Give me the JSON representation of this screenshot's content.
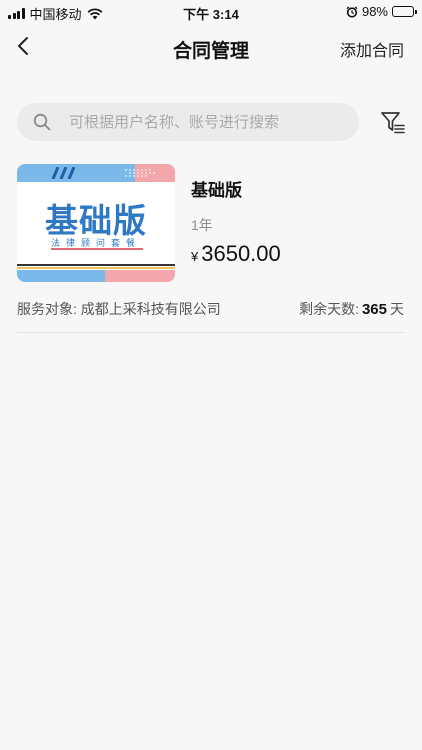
{
  "status_bar": {
    "carrier": "中国移动",
    "time": "下午 3:14",
    "battery": "98%"
  },
  "nav": {
    "title": "合同管理",
    "action": "添加合同"
  },
  "search": {
    "placeholder": "可根据用户名称、账号进行搜索",
    "value": ""
  },
  "contracts": [
    {
      "thumbnail": {
        "title": "基础版",
        "subtitle": "法律顾问套餐"
      },
      "name": "基础版",
      "period": "1年",
      "currency": "¥",
      "price": "3650.00",
      "service_label": "服务对象:",
      "service_target": "成都上采科技有限公司",
      "remaining_label": "剩余天数:",
      "remaining_days": "365",
      "remaining_unit": "天"
    }
  ],
  "colors": {
    "accent_blue": "#2f79c4",
    "band_blue": "#7ab9ea",
    "band_pink": "#f4a6ad",
    "battery_green": "#35c759"
  }
}
